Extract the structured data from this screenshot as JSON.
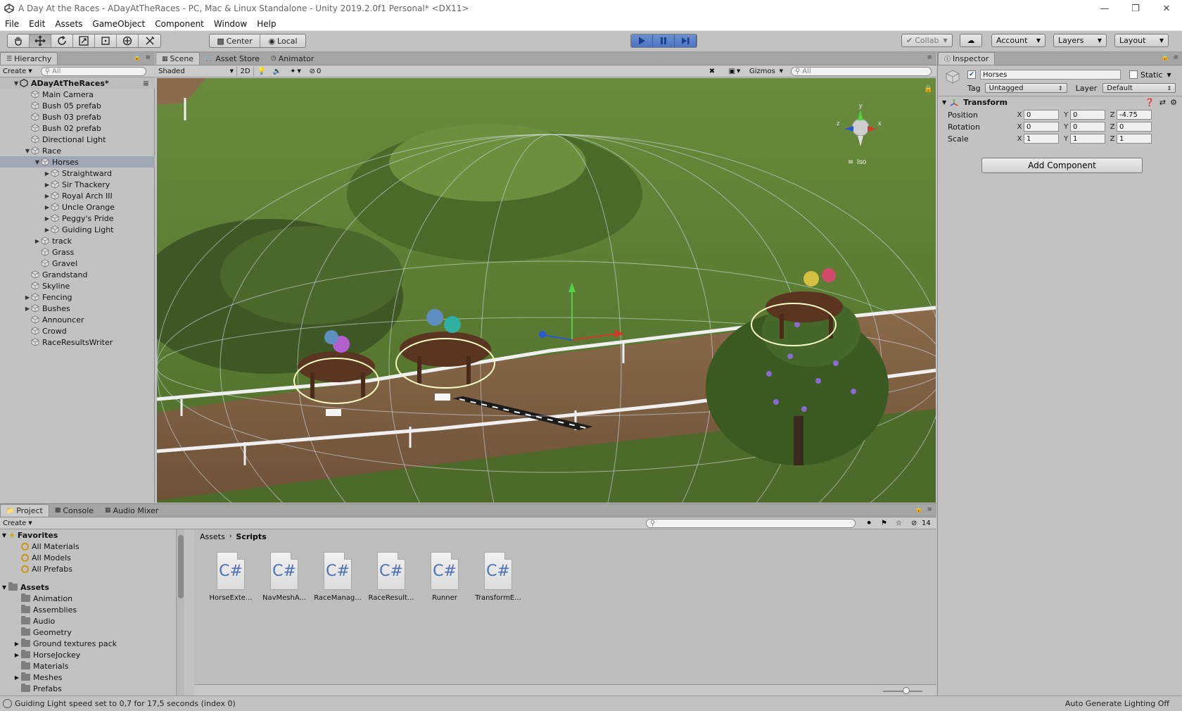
{
  "window": {
    "title": "A Day At the Races - ADayAtTheRaces - PC, Mac & Linux Standalone - Unity 2019.2.0f1 Personal* <DX11>"
  },
  "menu": [
    "File",
    "Edit",
    "Assets",
    "GameObject",
    "Component",
    "Window",
    "Help"
  ],
  "toolbar": {
    "tools": [
      "hand-tool",
      "move-tool",
      "rotate-tool",
      "scale-tool",
      "rect-tool",
      "transform-tool",
      "custom-tool"
    ],
    "pivot_mode": "Center",
    "pivot_rotation": "Local",
    "collab": "Collab",
    "account": "Account",
    "layers": "Layers",
    "layout": "Layout"
  },
  "hierarchy": {
    "tab": "Hierarchy",
    "create": "Create",
    "search_placeholder": "All",
    "scene": "ADayAtTheRaces*",
    "items": [
      {
        "label": "Main Camera",
        "depth": 1,
        "arrow": ""
      },
      {
        "label": "Bush 05 prefab",
        "depth": 1,
        "arrow": ""
      },
      {
        "label": "Bush 03 prefab",
        "depth": 1,
        "arrow": ""
      },
      {
        "label": "Bush 02 prefab",
        "depth": 1,
        "arrow": ""
      },
      {
        "label": "Directional Light",
        "depth": 1,
        "arrow": ""
      },
      {
        "label": "Race",
        "depth": 1,
        "arrow": "▼"
      },
      {
        "label": "Horses",
        "depth": 2,
        "arrow": "▼",
        "selected": true
      },
      {
        "label": "Straightward",
        "depth": 3,
        "arrow": "▶"
      },
      {
        "label": "Sir Thackery",
        "depth": 3,
        "arrow": "▶"
      },
      {
        "label": "Royal Arch III",
        "depth": 3,
        "arrow": "▶"
      },
      {
        "label": "Uncle Orange",
        "depth": 3,
        "arrow": "▶"
      },
      {
        "label": "Peggy's Pride",
        "depth": 3,
        "arrow": "▶"
      },
      {
        "label": "Guiding Light",
        "depth": 3,
        "arrow": "▶"
      },
      {
        "label": "track",
        "depth": 2,
        "arrow": "▶"
      },
      {
        "label": "Grass",
        "depth": 2,
        "arrow": ""
      },
      {
        "label": "Gravel",
        "depth": 2,
        "arrow": ""
      },
      {
        "label": "Grandstand",
        "depth": 1,
        "arrow": ""
      },
      {
        "label": "Skyline",
        "depth": 1,
        "arrow": ""
      },
      {
        "label": "Fencing",
        "depth": 1,
        "arrow": "▶"
      },
      {
        "label": "Bushes",
        "depth": 1,
        "arrow": "▶"
      },
      {
        "label": "Announcer",
        "depth": 1,
        "arrow": ""
      },
      {
        "label": "Crowd",
        "depth": 1,
        "arrow": ""
      },
      {
        "label": "RaceResultsWriter",
        "depth": 1,
        "arrow": ""
      }
    ]
  },
  "scene": {
    "tabs": [
      "Scene",
      "Asset Store",
      "Animator"
    ],
    "draw_mode": "Shaded",
    "mode_2d": "2D",
    "hidden_count": "0",
    "gizmos": "Gizmos",
    "search_placeholder": "All",
    "projection": "Iso",
    "axis_labels": {
      "y": "y",
      "x": "x",
      "z": "z"
    }
  },
  "inspector": {
    "tab": "Inspector",
    "object_name": "Horses",
    "static_label": "Static",
    "tag_label": "Tag",
    "tag_value": "Untagged",
    "layer_label": "Layer",
    "layer_value": "Default",
    "component": "Transform",
    "transform": [
      {
        "label": "Position",
        "x": "0",
        "y": "0",
        "z": "-4.75"
      },
      {
        "label": "Rotation",
        "x": "0",
        "y": "0",
        "z": "0"
      },
      {
        "label": "Scale",
        "x": "1",
        "y": "1",
        "z": "1"
      }
    ],
    "axes": [
      "X",
      "Y",
      "Z"
    ],
    "add_component": "Add Component"
  },
  "project": {
    "tabs": [
      "Project",
      "Console",
      "Audio Mixer"
    ],
    "create": "Create",
    "hidden_count": "14",
    "favorites_label": "Favorites",
    "favorites": [
      "All Materials",
      "All Models",
      "All Prefabs"
    ],
    "assets_label": "Assets",
    "folders": [
      {
        "label": "Animation",
        "arrow": ""
      },
      {
        "label": "Assemblies",
        "arrow": ""
      },
      {
        "label": "Audio",
        "arrow": ""
      },
      {
        "label": "Geometry",
        "arrow": ""
      },
      {
        "label": "Ground textures pack",
        "arrow": "▶"
      },
      {
        "label": "HorseJockey",
        "arrow": "▶"
      },
      {
        "label": "Materials",
        "arrow": ""
      },
      {
        "label": "Meshes",
        "arrow": "▶"
      },
      {
        "label": "Prefabs",
        "arrow": ""
      }
    ],
    "breadcrumb": [
      "Assets",
      "Scripts"
    ],
    "scripts": [
      "HorseExte...",
      "NavMeshA...",
      "RaceManag...",
      "RaceResult...",
      "Runner",
      "TransformE..."
    ],
    "file_glyph": "C#"
  },
  "status": {
    "message": "Guiding Light speed set to 0,7 for 17,5 seconds (index 0)",
    "lighting": "Auto Generate Lighting Off"
  }
}
